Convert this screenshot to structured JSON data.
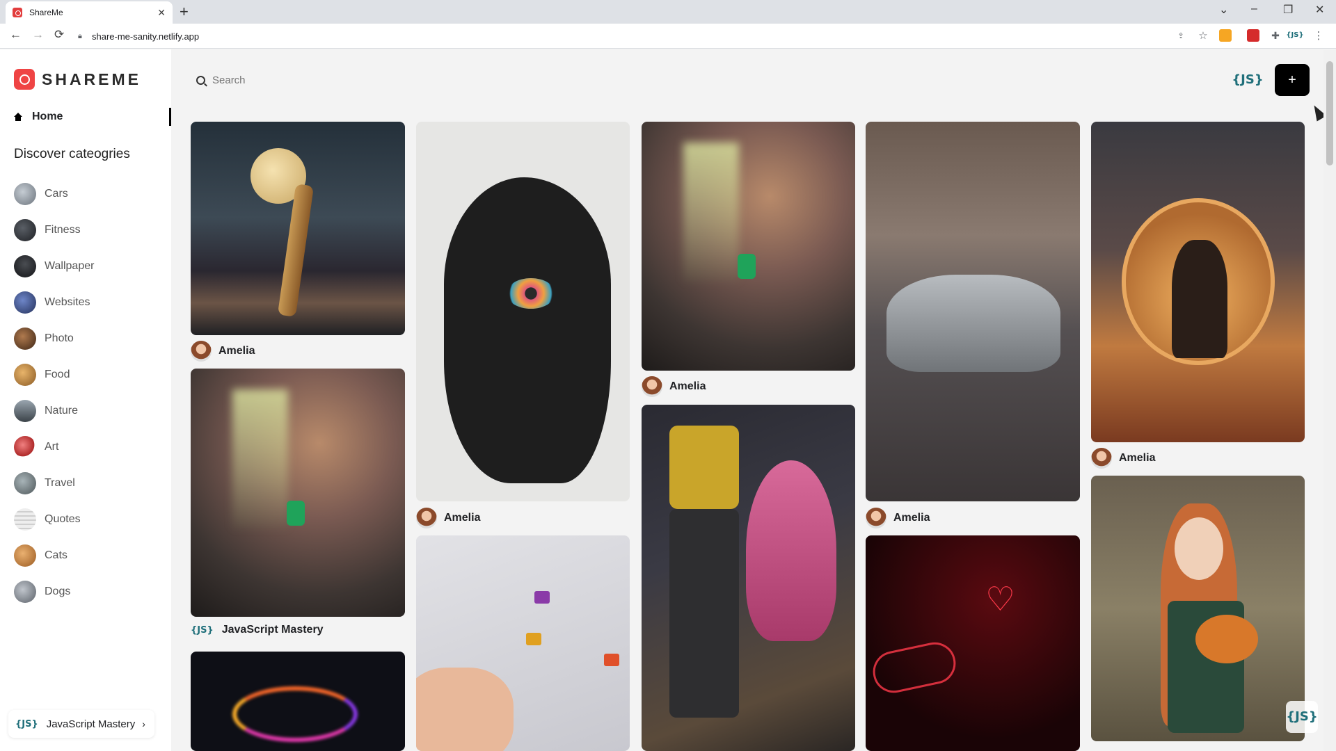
{
  "browser": {
    "tab_title": "ShareMe",
    "url": "share-me-sanity.netlify.app"
  },
  "app": {
    "logo_text": "SHAREME",
    "home_label": "Home",
    "discover_title": "Discover cateogries",
    "categories": [
      {
        "label": "Cars",
        "color": "#9aa3ad"
      },
      {
        "label": "Fitness",
        "color": "#3b3f44"
      },
      {
        "label": "Wallpaper",
        "color": "#222428"
      },
      {
        "label": "Websites",
        "color": "#3b4a7a"
      },
      {
        "label": "Photo",
        "color": "#7a4a2c"
      },
      {
        "label": "Food",
        "color": "#c98a3d"
      },
      {
        "label": "Nature",
        "color": "#5c6670"
      },
      {
        "label": "Art",
        "color": "#c94a4a"
      },
      {
        "label": "Travel",
        "color": "#6e7b80"
      },
      {
        "label": "Quotes",
        "color": "#e0e0e0"
      },
      {
        "label": "Cats",
        "color": "#d08a3a"
      },
      {
        "label": "Dogs",
        "color": "#8a8f96"
      }
    ],
    "account_name": "JavaScript Mastery",
    "js_logo": "{JS}",
    "search_placeholder": "Search",
    "create_label": "+"
  },
  "pins": [
    {
      "author": "Amelia",
      "desc": "giraffe-moon"
    },
    {
      "author": "JavaScript Mastery",
      "desc": "scooter-bokeh"
    },
    {
      "author": "",
      "desc": "neon-smoke"
    },
    {
      "author": "Amelia",
      "desc": "face-line-art"
    },
    {
      "author": "",
      "desc": "paint-palette-hand"
    },
    {
      "author": "Amelia",
      "desc": "scooter-bokeh"
    },
    {
      "author": "",
      "desc": "spongebob-patrick"
    },
    {
      "author": "Amelia",
      "desc": "grey-supercar"
    },
    {
      "author": "",
      "desc": "red-neon-collage"
    },
    {
      "author": "Amelia",
      "desc": "couple-ring"
    },
    {
      "author": "",
      "desc": "woman-fox"
    }
  ]
}
